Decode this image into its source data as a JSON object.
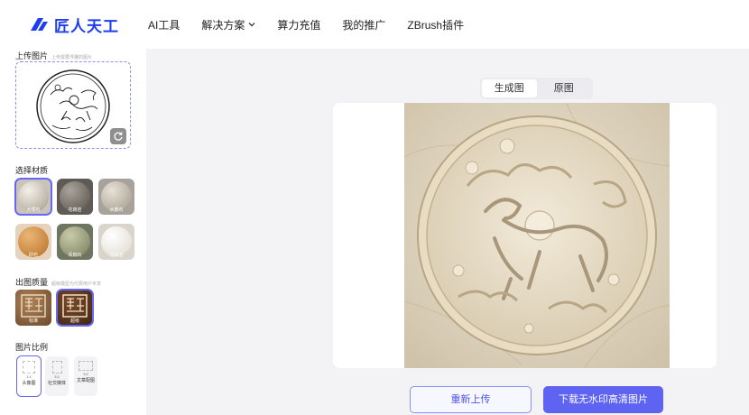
{
  "brand": {
    "name": "匠人天工",
    "color": "#1f3df0"
  },
  "nav": {
    "items": [
      {
        "label": "AI工具"
      },
      {
        "label": "解决方案",
        "has_dropdown": true
      },
      {
        "label": "算力充值"
      },
      {
        "label": "我的推广"
      },
      {
        "label": "ZBrush插件"
      }
    ]
  },
  "sidebar": {
    "upload": {
      "title": "上传图片",
      "hint": "上传需要浮雕的图片"
    },
    "material": {
      "title": "选择材质",
      "items": [
        {
          "label": "大理石",
          "selected": true
        },
        {
          "label": "花岗岩",
          "selected": false
        },
        {
          "label": "水磨石",
          "selected": false
        },
        {
          "label": "砂岩",
          "selected": false
        },
        {
          "label": "青田石",
          "selected": false
        },
        {
          "label": "汉白玉",
          "selected": false
        }
      ]
    },
    "quality": {
      "title": "出图质量",
      "hint": "超级模型为付费用户专享",
      "items": [
        {
          "label": "标准",
          "selected": false
        },
        {
          "label": "超级",
          "selected": true
        }
      ]
    },
    "ratio": {
      "title": "图片比例",
      "items": [
        {
          "ratio": "1:1",
          "label": "头像图",
          "selected": true
        },
        {
          "ratio": "3:2",
          "label": "社交媒体",
          "selected": false
        },
        {
          "ratio": "3:2",
          "label": "文章配图",
          "selected": false
        }
      ]
    }
  },
  "main": {
    "tabs": [
      {
        "label": "生成图",
        "active": true
      },
      {
        "label": "原图",
        "active": false
      }
    ],
    "reupload_label": "重新上传",
    "download_label": "下载无水印高清图片"
  },
  "colors": {
    "accent": "#5f63f2",
    "main_bg": "#f3f3f5"
  }
}
